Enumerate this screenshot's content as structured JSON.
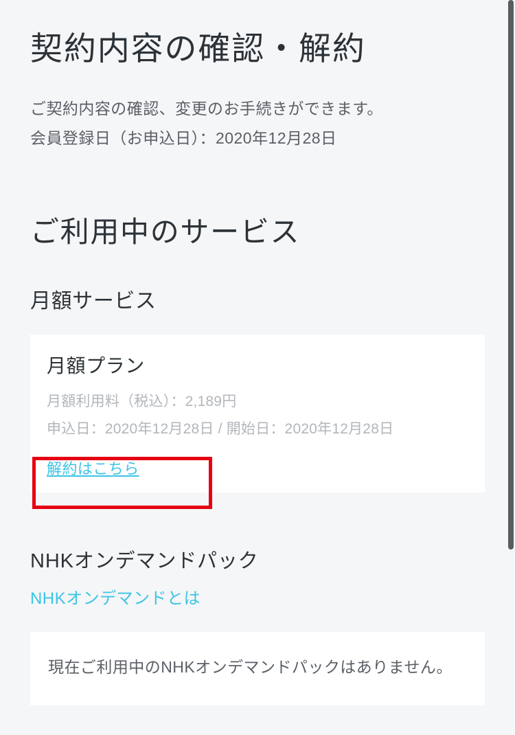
{
  "page": {
    "title": "契約内容の確認・解約",
    "intro_line1": "ご契約内容の確認、変更のお手続きができます。",
    "intro_line2": "会員登録日（お申込日）：2020年12月28日"
  },
  "services": {
    "heading": "ご利用中のサービス",
    "monthly": {
      "subheading": "月額サービス",
      "plan_name": "月額プラン",
      "fee_line": "月額利用料（税込）：2,189円",
      "date_line": "申込日：2020年12月28日 / 開始日：2020年12月28日",
      "cancel_label": "解約はこちら"
    },
    "nhk": {
      "subheading": "NHKオンデマンドパック",
      "about_link": "NHKオンデマンドとは",
      "empty_message": "現在ご利用中のNHKオンデマンドパックはありません。"
    }
  }
}
